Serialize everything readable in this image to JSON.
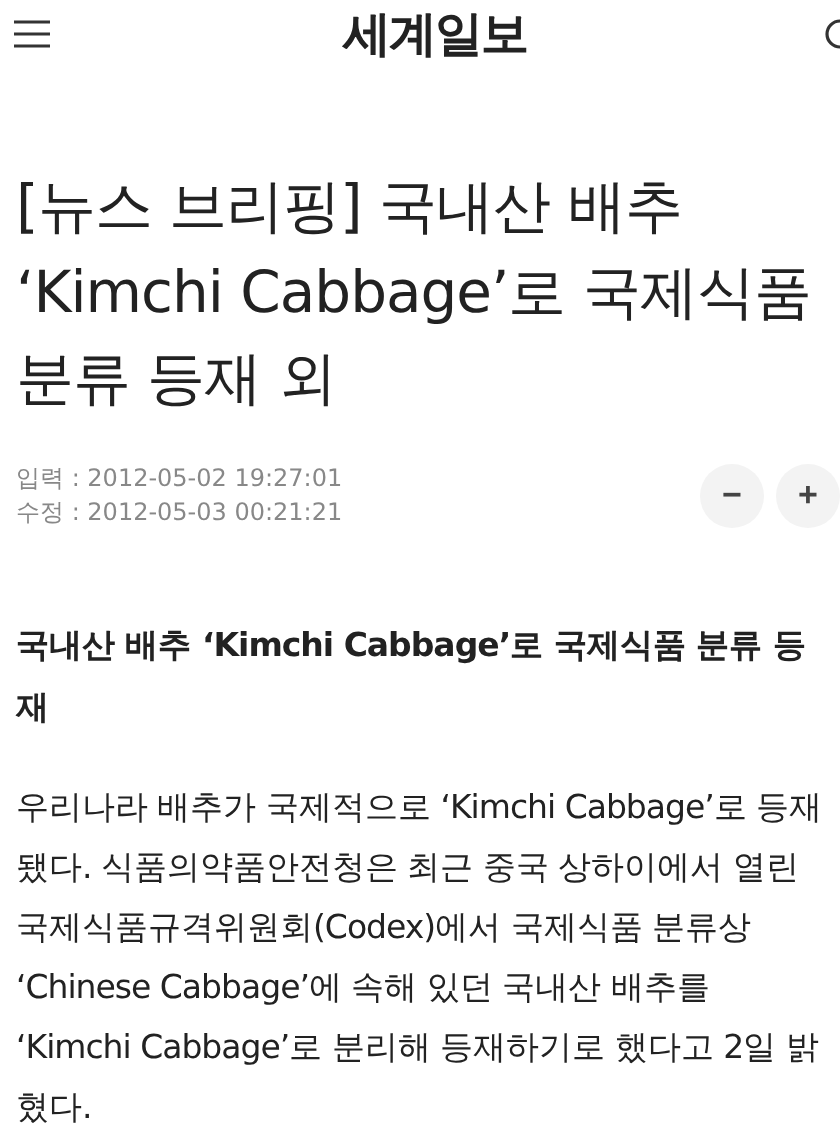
{
  "header": {
    "logo": "세계일보"
  },
  "article": {
    "title": "[뉴스 브리핑] 국내산 배추 ‘Kimchi Cabbage’로 국제식품 분류 등재 외",
    "dates": [
      "입력 : 2012-05-02 19:27:01",
      "수정 : 2012-05-03 00:21:21"
    ],
    "font_buttons": [
      "−",
      "+"
    ],
    "subtitle": "국내산 배추 ‘Kimchi Cabbage’로 국제식품 분류 등재",
    "body": "우리나라 배추가 국제적으로 ‘Kimchi Cabbage’로 등재됐다. 식품의약품안전청은 최근 중국 상하이에서 열린 국제식품규격위원회(Codex)에서 국제식품 분류상 ‘Chinese Cabbage’에 속해 있던 국내산 배추를 ‘Kimchi Cabbage’로 분리해 등재하기로 했다고 2일 밝혔다."
  }
}
